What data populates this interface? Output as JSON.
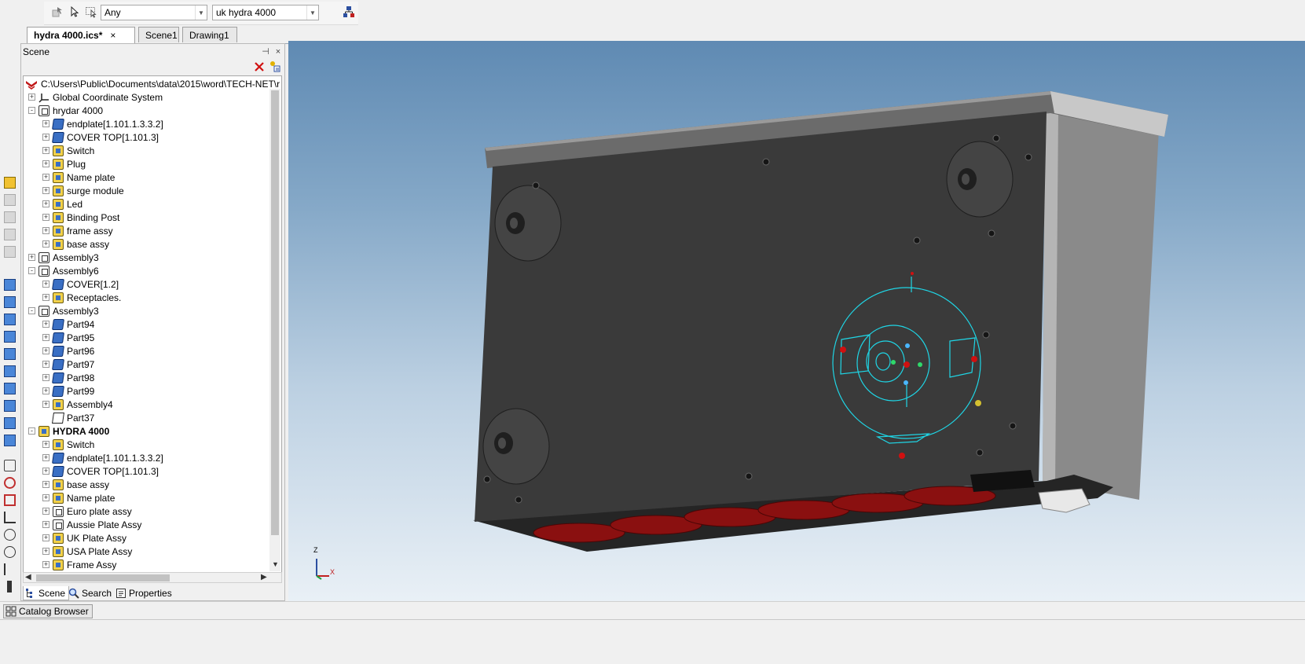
{
  "toolbar": {
    "filter_value": "Any",
    "config_value": "uk hydra 4000"
  },
  "tabs": [
    {
      "label": "hydra 4000.ics*",
      "close": "×"
    },
    {
      "label": "Scene1"
    },
    {
      "label": "Drawing1"
    }
  ],
  "panel": {
    "title": "Scene",
    "pin": "⊣",
    "close": "×"
  },
  "tree": {
    "root_path": "C:\\Users\\Public\\Documents\\data\\2015\\word\\TECH-NET\\r",
    "items": [
      {
        "label": "Global Coordinate System",
        "icon": "axes-icon"
      },
      {
        "label": "hrydar 4000",
        "icon": "group-icon"
      },
      {
        "label": "endplate[1.101.1.3.3.2]",
        "icon": "part-icon"
      },
      {
        "label": "COVER TOP[1.101.3]",
        "icon": "part-icon"
      },
      {
        "label": "Switch",
        "icon": "assembly-icon"
      },
      {
        "label": "Plug",
        "icon": "assembly-icon"
      },
      {
        "label": "Name plate",
        "icon": "assembly-icon"
      },
      {
        "label": "surge module",
        "icon": "assembly-icon"
      },
      {
        "label": "Led",
        "icon": "assembly-icon"
      },
      {
        "label": "Binding Post",
        "icon": "assembly-icon"
      },
      {
        "label": "frame assy",
        "icon": "assembly-icon"
      },
      {
        "label": "base assy",
        "icon": "assembly-icon"
      },
      {
        "label": "Assembly3",
        "icon": "group-icon"
      },
      {
        "label": "Assembly6",
        "icon": "group-icon"
      },
      {
        "label": "COVER[1.2]",
        "icon": "part-icon"
      },
      {
        "label": "Receptacles.",
        "icon": "assembly-icon"
      },
      {
        "label": "Assembly3",
        "icon": "group-icon"
      },
      {
        "label": "Part94",
        "icon": "part-icon"
      },
      {
        "label": "Part95",
        "icon": "part-icon"
      },
      {
        "label": "Part96",
        "icon": "part-icon"
      },
      {
        "label": "Part97",
        "icon": "part-icon"
      },
      {
        "label": "Part98",
        "icon": "part-icon"
      },
      {
        "label": "Part99",
        "icon": "part-icon"
      },
      {
        "label": "Assembly4",
        "icon": "assembly-icon"
      },
      {
        "label": "Part37",
        "icon": "wire-part-icon"
      },
      {
        "label": "HYDRA 4000",
        "icon": "assembly-icon"
      },
      {
        "label": "Switch",
        "icon": "assembly-icon"
      },
      {
        "label": "endplate[1.101.1.3.3.2]",
        "icon": "part-icon"
      },
      {
        "label": "COVER TOP[1.101.3]",
        "icon": "part-icon"
      },
      {
        "label": "base assy",
        "icon": "assembly-icon"
      },
      {
        "label": "Name plate",
        "icon": "assembly-icon"
      },
      {
        "label": "Euro plate assy",
        "icon": "group-icon"
      },
      {
        "label": "Aussie Plate Assy",
        "icon": "group-icon"
      },
      {
        "label": "UK Plate Assy",
        "icon": "assembly-icon"
      },
      {
        "label": "USA Plate Assy",
        "icon": "assembly-icon"
      },
      {
        "label": "Frame Assy",
        "icon": "assembly-icon"
      }
    ]
  },
  "panel_tabs": {
    "scene": "Scene",
    "search": "Search",
    "properties": "Properties"
  },
  "triad": {
    "z": "Z",
    "x": "X"
  },
  "catalog_browser": "Catalog Browser",
  "colors": {
    "accent": "#3a6fc4",
    "handle_red": "#d01010",
    "wireframe_cyan": "#1fd6e6",
    "body_dark": "#3c3c3c"
  }
}
